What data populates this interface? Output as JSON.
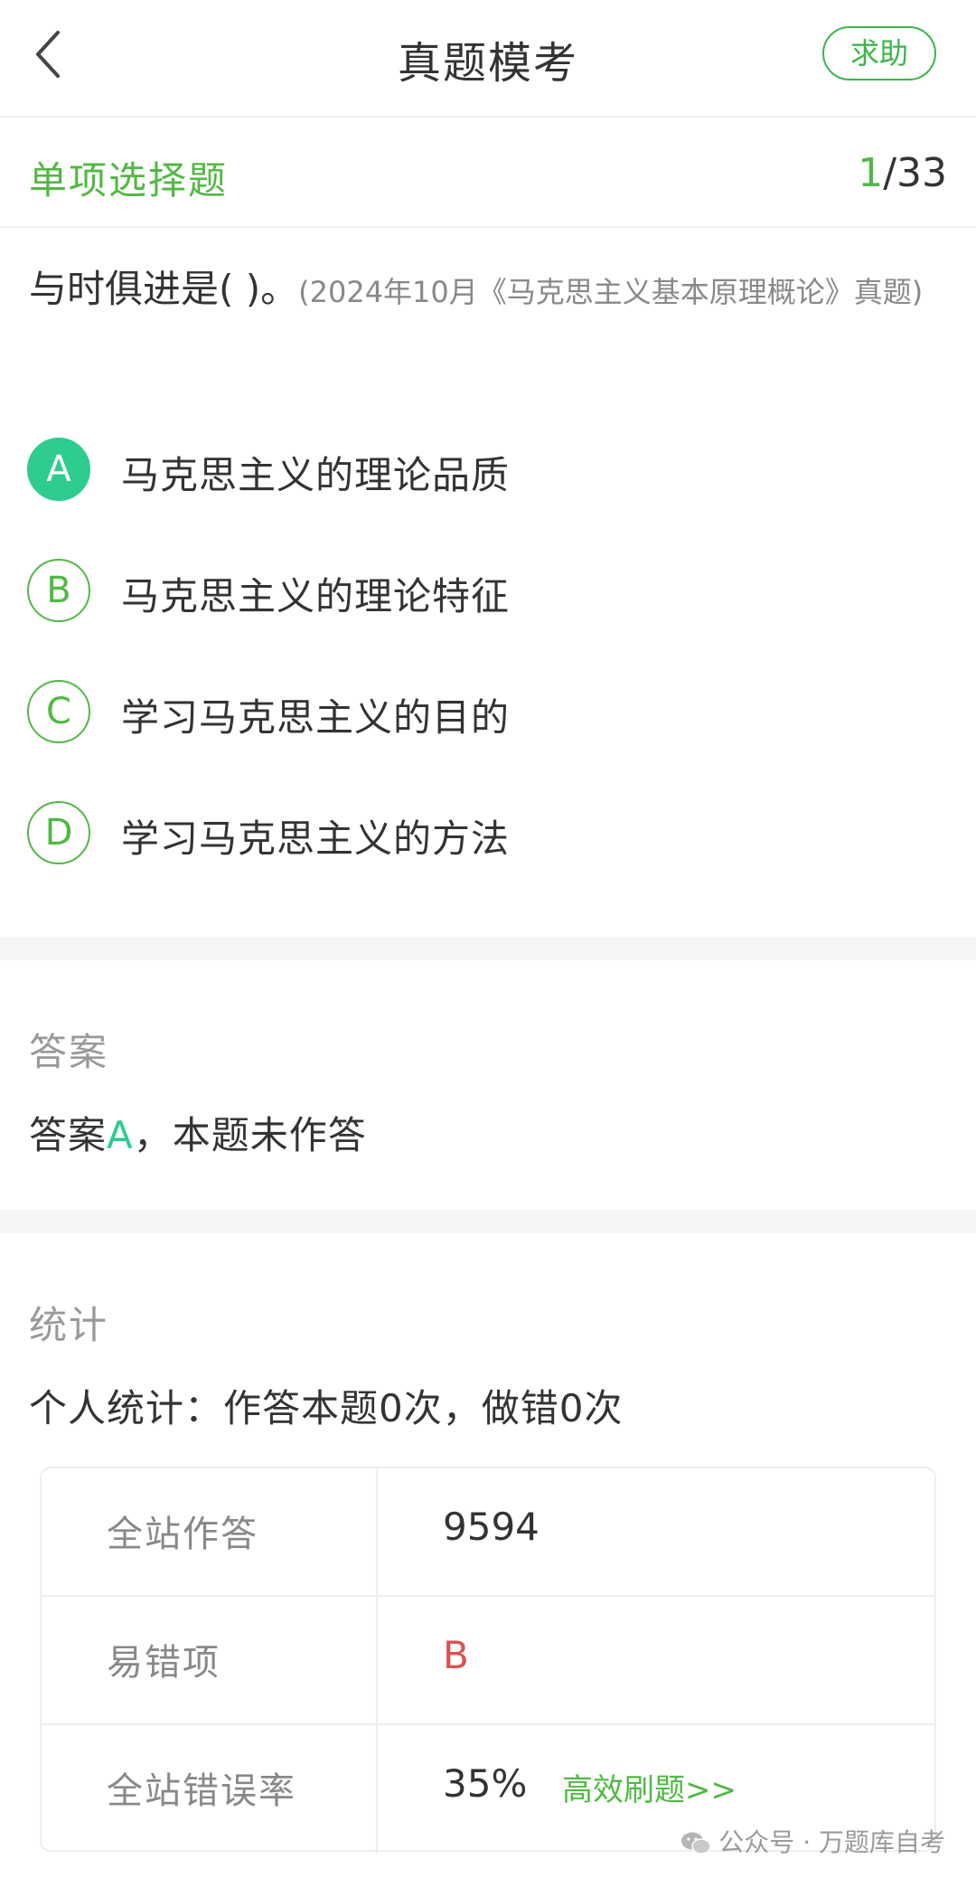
{
  "header": {
    "title": "真题模考",
    "help_label": "求助"
  },
  "question_type": {
    "label": "单项选择题",
    "current": "1",
    "separator_total": "/33"
  },
  "question": {
    "stem": "与时俱进是( )。",
    "source": "(2024年10月《马克思主义基本原理概论》真题)"
  },
  "options": [
    {
      "letter": "A",
      "text": "马克思主义的理论品质",
      "selected": true
    },
    {
      "letter": "B",
      "text": "马克思主义的理论特征",
      "selected": false
    },
    {
      "letter": "C",
      "text": "学习马克思主义的目的",
      "selected": false
    },
    {
      "letter": "D",
      "text": "学习马克思主义的方法",
      "selected": false
    }
  ],
  "answer": {
    "title": "答案",
    "prefix": "答案",
    "letter": "A",
    "suffix": "，本题未作答"
  },
  "stats": {
    "title": "统计",
    "personal": "个人统计：作答本题0次，做错0次",
    "rows": [
      {
        "key": "全站作答",
        "value": "9594"
      },
      {
        "key": "易错项",
        "value": "B"
      },
      {
        "key": "全站错误率",
        "value": "35%",
        "link": "高效刷题>>"
      }
    ]
  },
  "watermark": "公众号 · 万题库自考",
  "colors": {
    "accent_green": "#52b844",
    "selected_teal": "#2ecc8f",
    "error_red": "#d9534f"
  }
}
